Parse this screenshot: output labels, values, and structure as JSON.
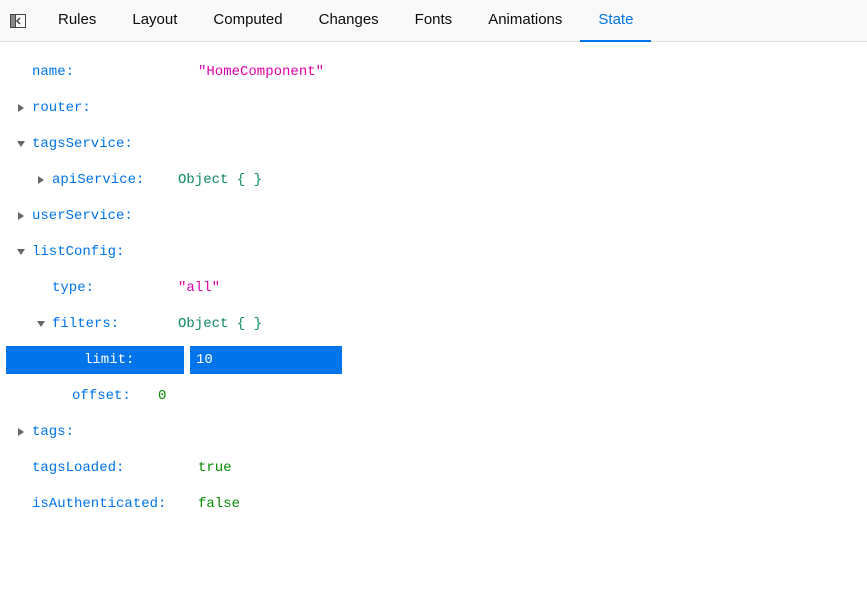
{
  "tabs": {
    "rules": "Rules",
    "layout": "Layout",
    "computed": "Computed",
    "changes": "Changes",
    "fonts": "Fonts",
    "animations": "Animations",
    "state": "State"
  },
  "state": {
    "name_key": "name:",
    "name_val": "\"HomeComponent\"",
    "router_key": "router:",
    "tagsService_key": "tagsService:",
    "apiService_key": "apiService:",
    "apiService_val": "Object {  }",
    "userService_key": "userService:",
    "listConfig_key": "listConfig:",
    "type_key": "type:",
    "type_val": "\"all\"",
    "filters_key": "filters:",
    "filters_val": "Object {  }",
    "limit_key": "limit:",
    "limit_val": "10",
    "offset_key": "offset:",
    "offset_val": "0",
    "tags_key": "tags:",
    "tagsLoaded_key": "tagsLoaded:",
    "tagsLoaded_val": "true",
    "isAuthenticated_key": "isAuthenticated:",
    "isAuthenticated_val": "false"
  }
}
